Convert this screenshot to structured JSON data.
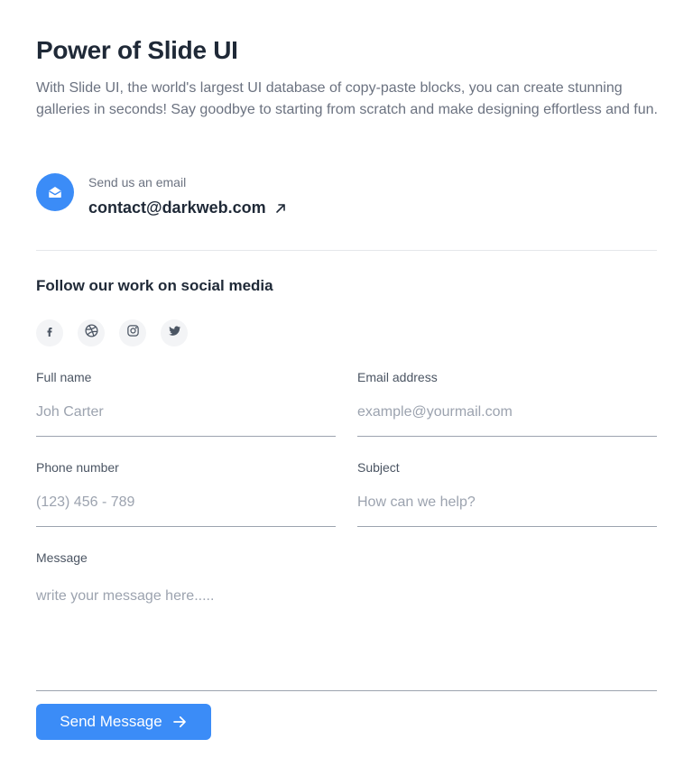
{
  "header": {
    "title": "Power of Slide UI",
    "description": "With Slide UI, the world's largest UI database of copy-paste blocks, you can create stunning galleries in seconds! Say goodbye to starting from scratch and make designing effortless and fun."
  },
  "contact": {
    "label": "Send us an email",
    "email": "contact@darkweb.com",
    "icon": "envelope-open-icon",
    "link_icon": "arrow-up-right-icon"
  },
  "social": {
    "title": "Follow our work on social media",
    "items": [
      {
        "icon": "facebook-icon"
      },
      {
        "icon": "dribbble-icon"
      },
      {
        "icon": "instagram-icon"
      },
      {
        "icon": "twitter-icon"
      }
    ]
  },
  "form": {
    "full_name": {
      "label": "Full name",
      "placeholder": "Joh Carter"
    },
    "email": {
      "label": "Email address",
      "placeholder": "example@yourmail.com"
    },
    "phone": {
      "label": "Phone number",
      "placeholder": "(123) 456 - 789"
    },
    "subject": {
      "label": "Subject",
      "placeholder": "How can we help?"
    },
    "message": {
      "label": "Message",
      "placeholder": "write your message here....."
    },
    "submit_label": "Send Message"
  },
  "colors": {
    "accent": "#3b8cf7",
    "text": "#1f2937",
    "muted": "#6b7280"
  }
}
